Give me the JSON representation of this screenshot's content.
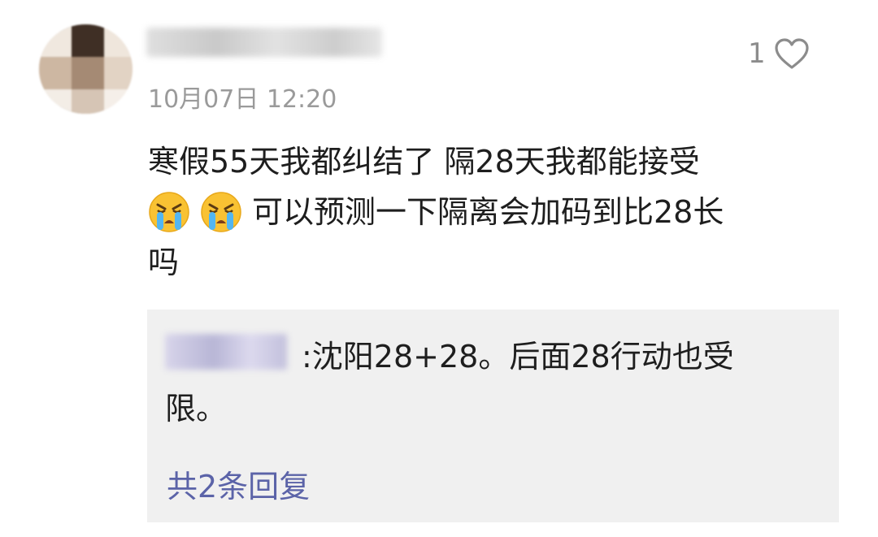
{
  "comment": {
    "timestamp": "10月07日 12:20",
    "like_count": "1",
    "lines": [
      "寒假55天我都纠结了 隔28天我都能接受",
      "可以预测一下隔离会加码到比28长",
      "吗"
    ]
  },
  "reply": {
    "text": ":沈阳28+28。后面28行动也受限。",
    "more_label": "共2条回复"
  },
  "icons": {
    "like": "heart-outline-icon",
    "emoji": "crying-face-emoji"
  },
  "colors": {
    "link": "#5b63a8",
    "timestamp": "#9a9a9a",
    "reply_background": "#f0f0f0"
  }
}
